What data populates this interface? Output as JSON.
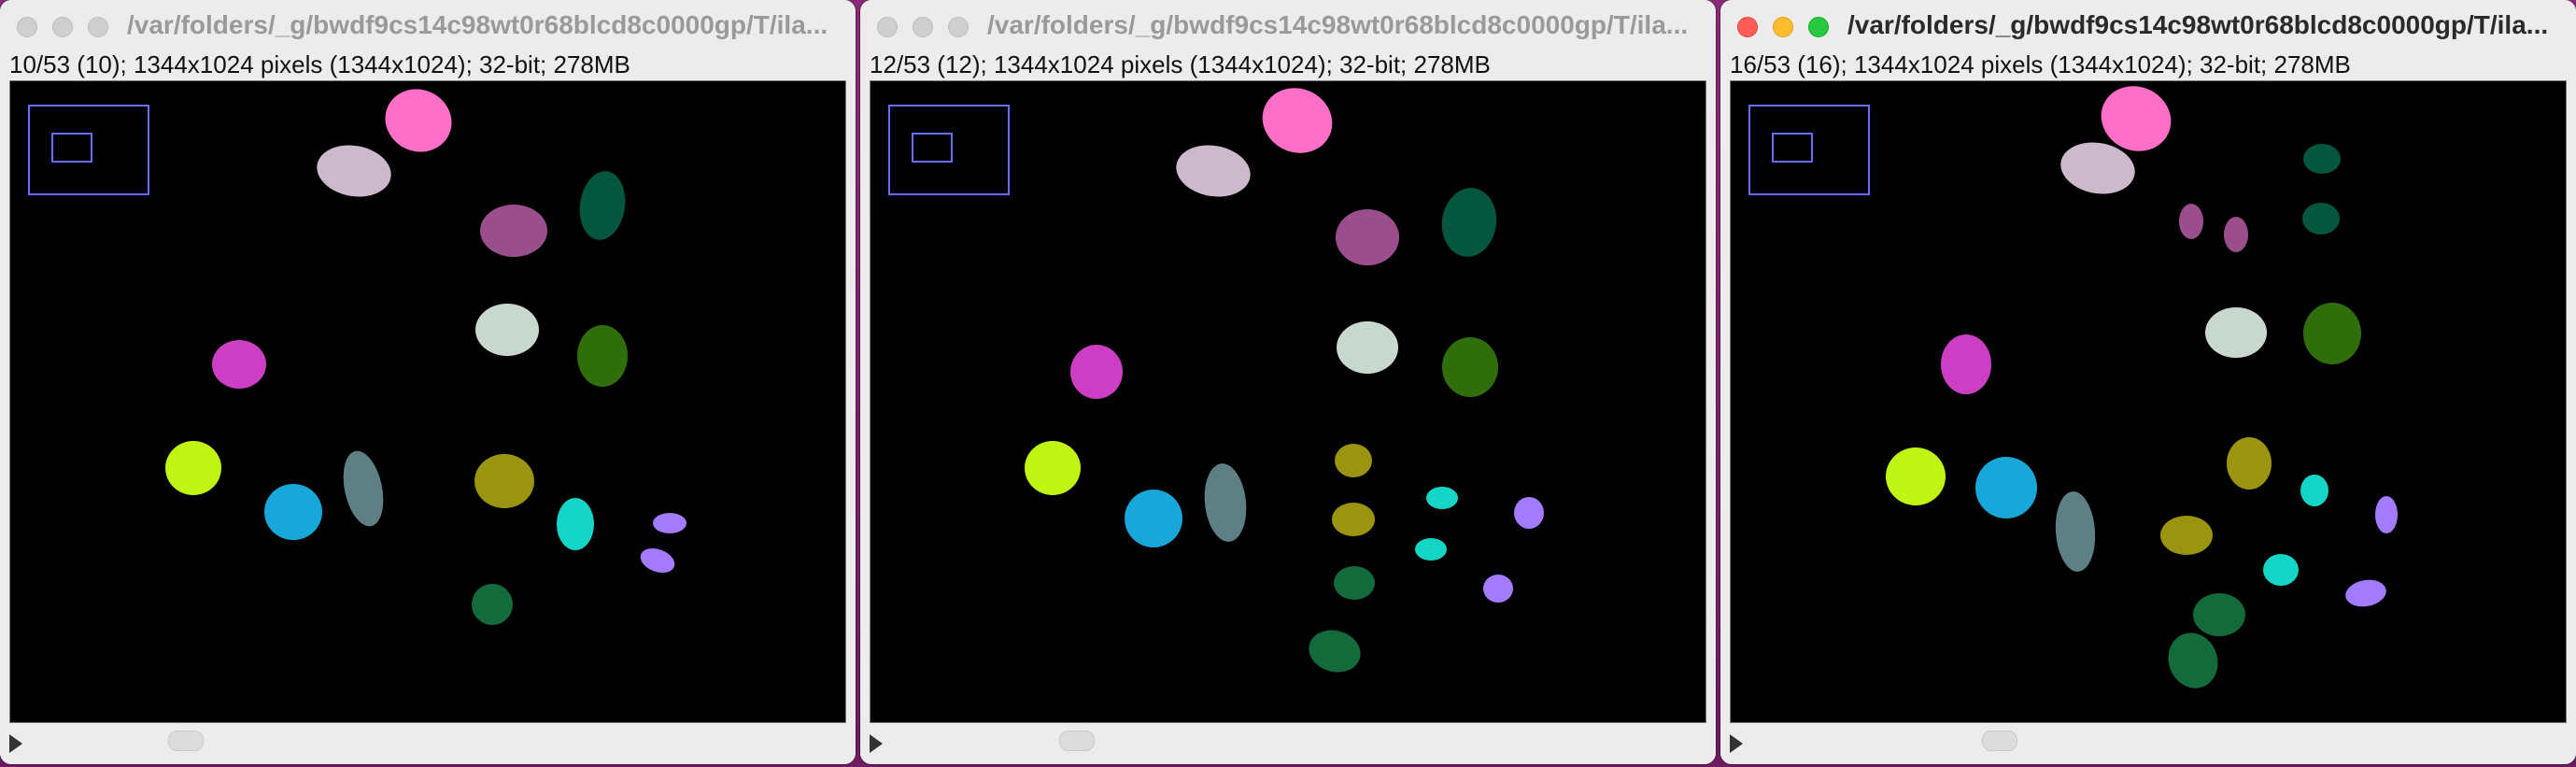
{
  "windows": [
    {
      "title": "/var/folders/_g/bwdf9cs14c98wt0r68blcd8c0000gp/T/ila...",
      "info": "10/53 (10); 1344x1024 pixels (1344x1024); 32-bit; 278MB",
      "active": false,
      "slice": 10,
      "slice_count": 53
    },
    {
      "title": "/var/folders/_g/bwdf9cs14c98wt0r68blcd8c0000gp/T/ila...",
      "info": "12/53 (12); 1344x1024 pixels (1344x1024); 32-bit; 278MB",
      "active": false,
      "slice": 12,
      "slice_count": 53
    },
    {
      "title": "/var/folders/_g/bwdf9cs14c98wt0r68blcd8c0000gp/T/ila...",
      "info": "16/53 (16); 1344x1024 pixels (1344x1024); 32-bit; 278MB",
      "active": true,
      "slice": 16,
      "slice_count": 53
    }
  ],
  "colors": {
    "canvas_background": "#000000",
    "overview_box": "#6b6bff",
    "pink": "#ff6ec7",
    "lilac": "#cdb9cc",
    "mauve": "#9a4f8c",
    "dark_green": "#04563e",
    "pale": "#c8d8cf",
    "green": "#2f6e0b",
    "magenta": "#cc3fc5",
    "lime": "#c0f412",
    "blue": "#17a7d8",
    "slate": "#5e8084",
    "olive": "#9b9410",
    "cyan": "#14d5c6",
    "violet": "#a27bff",
    "forest": "#136a3b"
  }
}
